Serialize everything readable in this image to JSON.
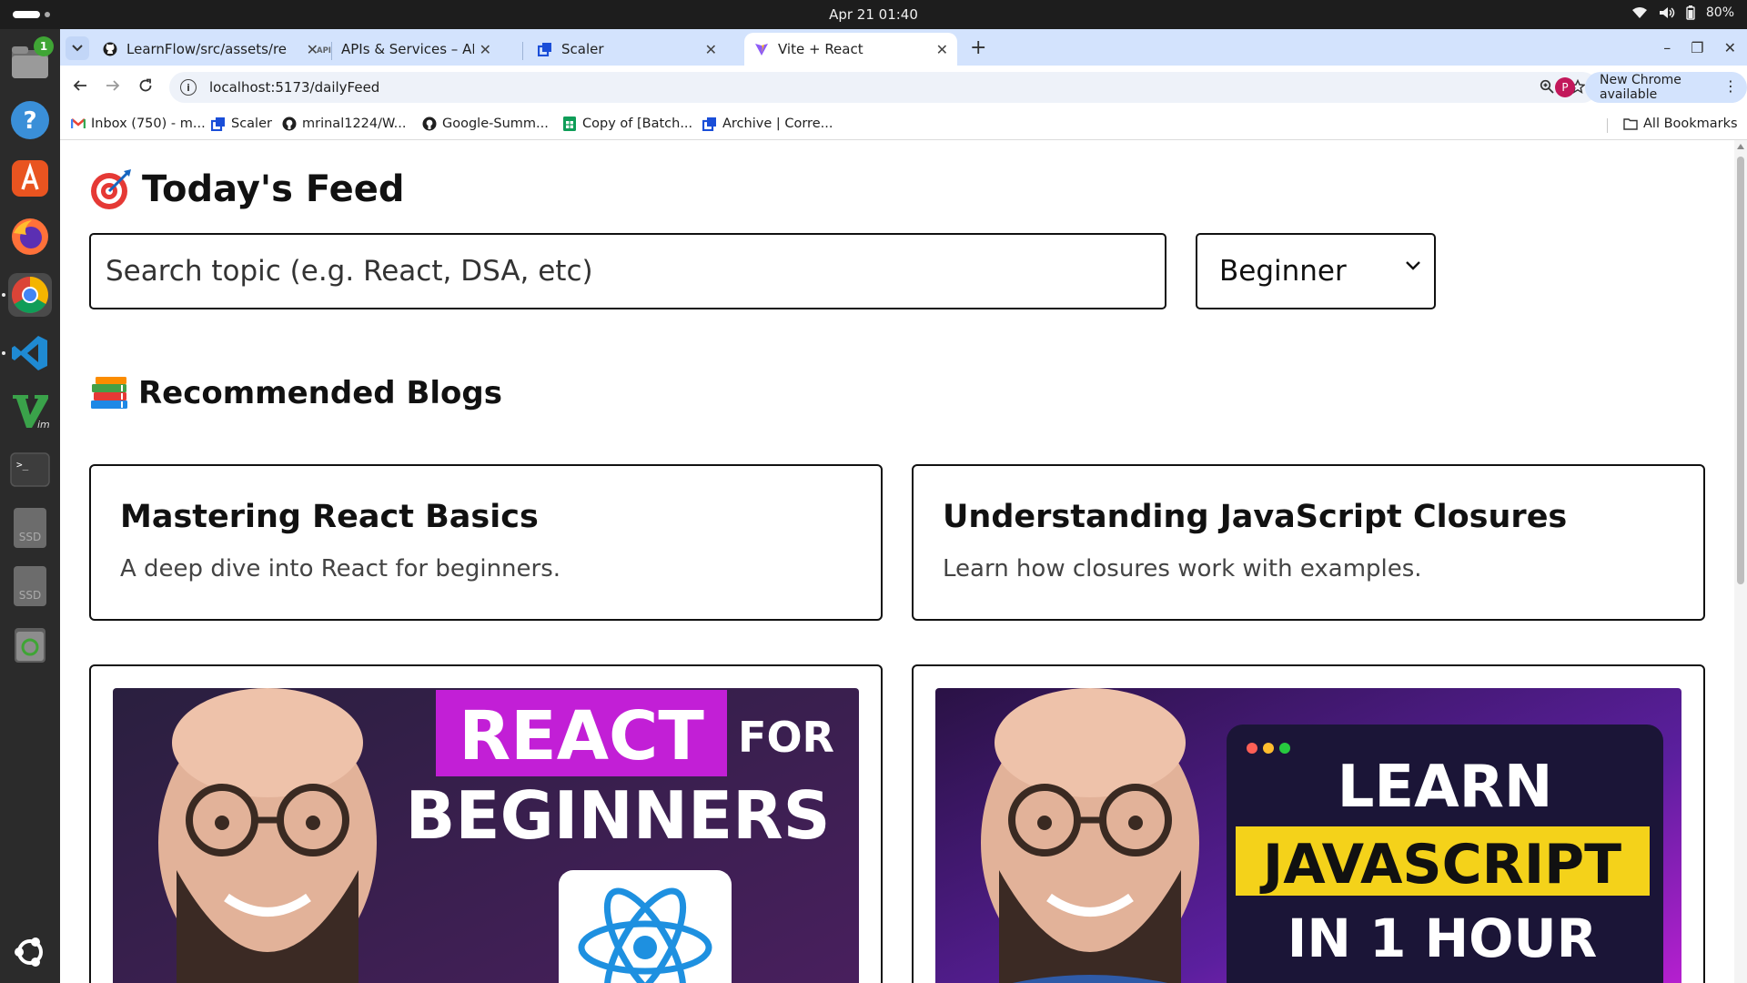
{
  "system": {
    "clock": "Apr 21  01:40",
    "battery": "80%",
    "files_badge": "1"
  },
  "dock": {
    "items": [
      "files-icon",
      "help-icon",
      "app-center-icon",
      "firefox-icon",
      "chrome-icon",
      "vscode-icon",
      "vim-icon",
      "terminal-icon",
      "ssd-drive-icon",
      "ssd-drive-icon",
      "trash-icon",
      "ubuntu-apps-icon"
    ],
    "ssd_label": "SSD"
  },
  "browser": {
    "tabs": [
      {
        "title": "LearnFlow/src/assets/re",
        "icon": "github-icon",
        "active": false
      },
      {
        "title": "APIs & Services – APIs & S",
        "icon": "api-icon",
        "active": false
      },
      {
        "title": "Scaler",
        "icon": "scaler-icon",
        "active": false
      },
      {
        "title": "Vite + React",
        "icon": "vite-icon",
        "active": true
      }
    ],
    "url": "localhost:5173/dailyFeed",
    "profile_initial": "P",
    "update_label": "New Chrome available",
    "bookmarks": [
      {
        "label": "Inbox (750) - m...",
        "icon": "gmail-icon"
      },
      {
        "label": "Scaler",
        "icon": "scaler-icon"
      },
      {
        "label": "mrinal1224/W...",
        "icon": "github-icon"
      },
      {
        "label": "Google-Summ...",
        "icon": "github-icon"
      },
      {
        "label": "Copy of [Batch...",
        "icon": "sheets-icon"
      },
      {
        "label": "Archive | Corre...",
        "icon": "scaler-icon"
      }
    ],
    "all_bookmarks": "All Bookmarks"
  },
  "page": {
    "title_emoji": "target-icon",
    "title": "Today's Feed",
    "search_placeholder": "Search topic (e.g. React, DSA, etc)",
    "level_selected": "Beginner",
    "section_title": "Recommended Blogs",
    "section_emoji": "books-icon",
    "blogs": [
      {
        "title": "Mastering React Basics",
        "description": "A deep dive into React for beginners."
      },
      {
        "title": "Understanding JavaScript Closures",
        "description": "Learn how closures work with examples."
      }
    ],
    "videos": [
      {
        "thumb_line1": "REACT",
        "thumb_line2": "FOR",
        "thumb_line3": "BEGINNERS",
        "accent": "#c21fd6"
      },
      {
        "thumb_line1": "LEARN",
        "thumb_line2": "JAVASCRIPT",
        "thumb_line3": "IN 1 HOUR",
        "accent": "#f4d21a"
      }
    ]
  }
}
